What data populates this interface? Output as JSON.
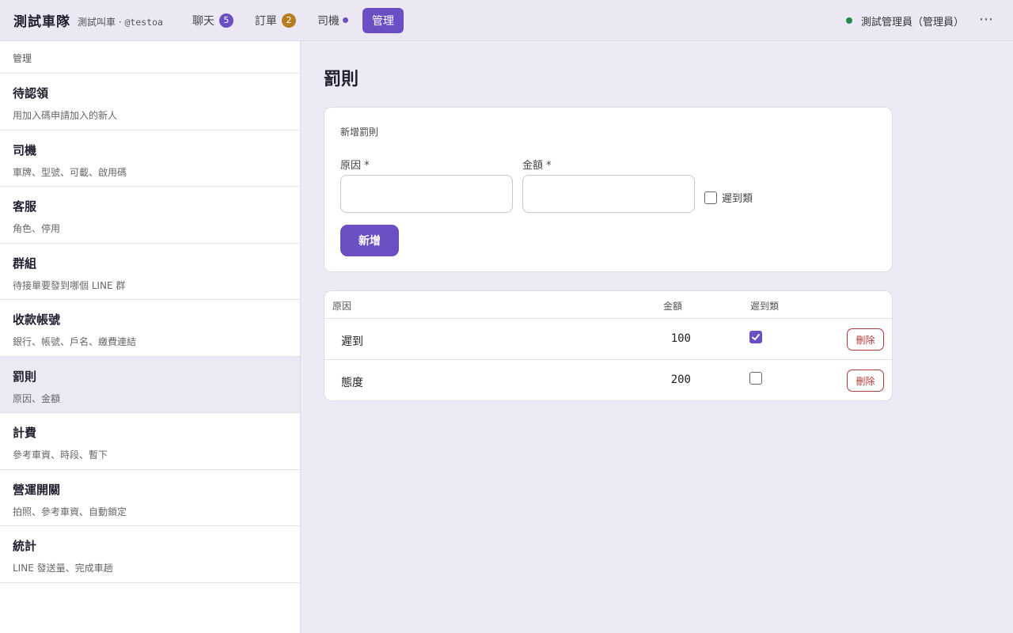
{
  "header": {
    "brand": "測試車隊",
    "org_name": "測試叫車 ·",
    "handle": "@testoa",
    "nav": [
      {
        "label": "聊天",
        "badge": "5"
      },
      {
        "label": "訂單",
        "badge": "2"
      },
      {
        "label": "司機"
      },
      {
        "label": "管理"
      }
    ],
    "user": "測試管理員（管理員）",
    "more": "⋯"
  },
  "sidebar": {
    "heading": "管理",
    "items": [
      {
        "title": "待認領",
        "desc": "用加入碼申請加入的新人"
      },
      {
        "title": "司機",
        "desc": "車牌、型號、可載、啟用碼"
      },
      {
        "title": "客服",
        "desc": "角色、停用"
      },
      {
        "title": "群組",
        "desc": "待接單要發到哪個 LINE 群"
      },
      {
        "title": "收款帳號",
        "desc": "銀行、帳號、戶名、繳費連結"
      },
      {
        "title": "罰則",
        "desc": "原因、金額"
      },
      {
        "title": "計費",
        "desc": "參考車資、時段、暫下"
      },
      {
        "title": "營運開關",
        "desc": "拍照、參考車資、自動鎖定"
      },
      {
        "title": "統計",
        "desc": "LINE 發送量、完成車趟"
      }
    ]
  },
  "main": {
    "title": "罰則",
    "form": {
      "title": "新增罰則",
      "reason_label": "原因 *",
      "reason_value": "",
      "amount_label": "金額 *",
      "amount_value": "",
      "late_label": "遲到類",
      "late_checked": false,
      "submit_label": "新增"
    },
    "table": {
      "headers": {
        "reason": "原因",
        "amount": "金額",
        "late": "遲到類"
      },
      "rows": [
        {
          "reason": "遲到",
          "amount": "100",
          "late": true,
          "delete_label": "刪除"
        },
        {
          "reason": "態度",
          "amount": "200",
          "late": false,
          "delete_label": "刪除"
        }
      ]
    }
  },
  "colors": {
    "accent": "#6a4fc4",
    "badge_orders": "#b77c1e",
    "online": "#1f8a4c",
    "danger": "#b23a3a"
  }
}
